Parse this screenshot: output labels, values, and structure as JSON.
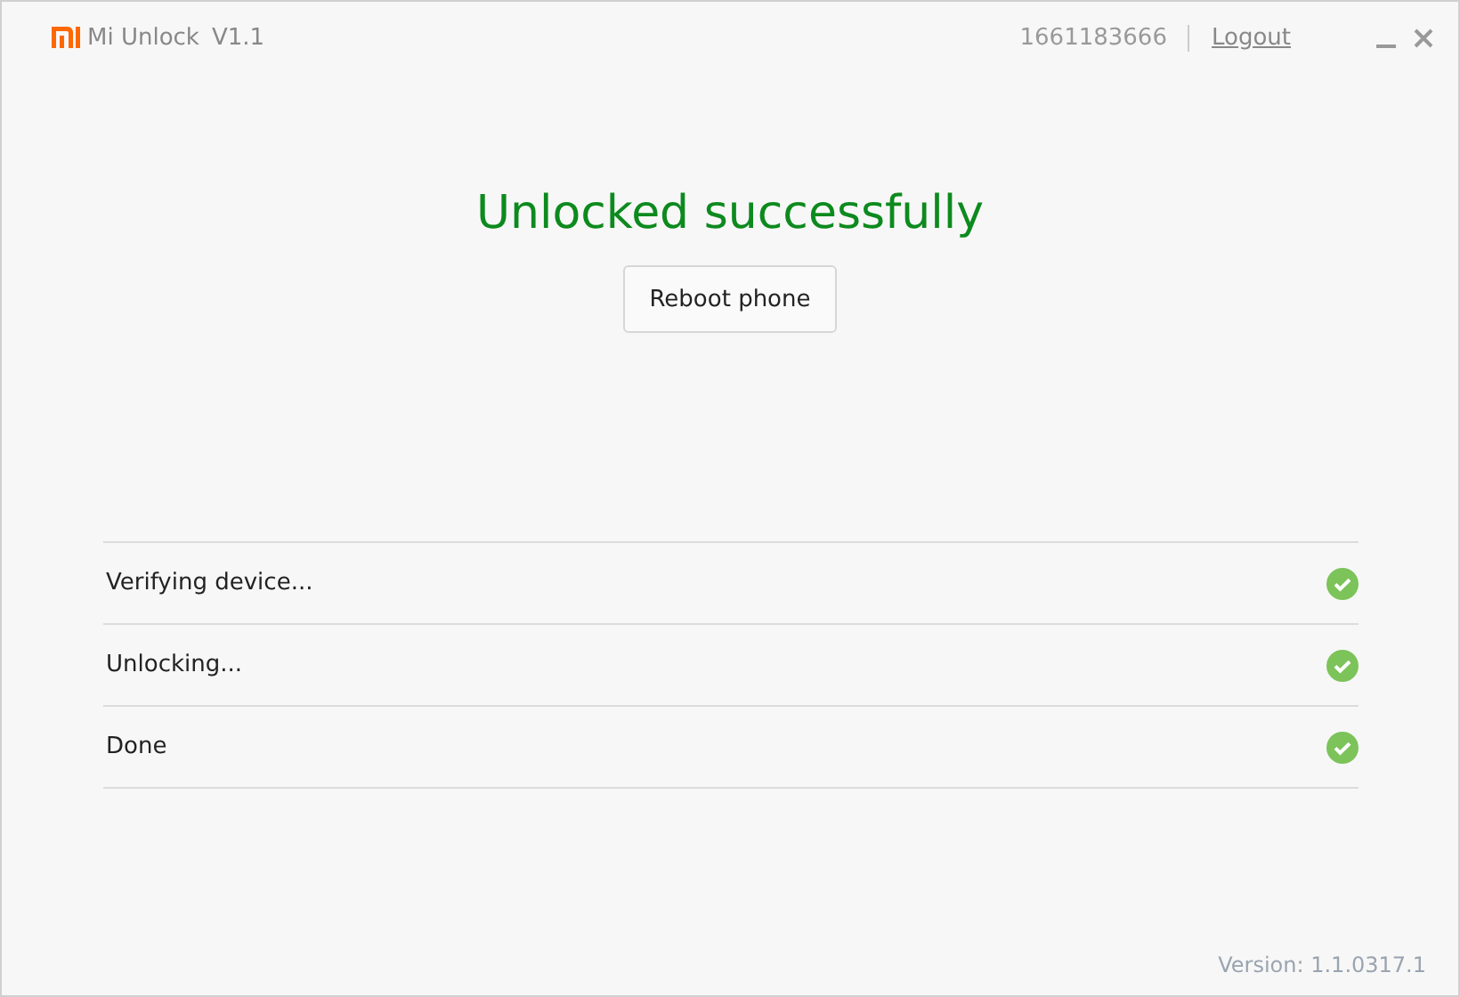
{
  "window": {
    "title": "Mi Unlock",
    "version": "V1.1"
  },
  "account": {
    "id": "1661183666",
    "logout": "Logout"
  },
  "status": {
    "heading": "Unlocked successfully",
    "button": "Reboot phone"
  },
  "steps": [
    {
      "label": "Verifying device...",
      "done": true
    },
    {
      "label": "Unlocking...",
      "done": true
    },
    {
      "label": "Done",
      "done": true
    }
  ],
  "footer": {
    "version": "Version: 1.1.0317.1"
  }
}
